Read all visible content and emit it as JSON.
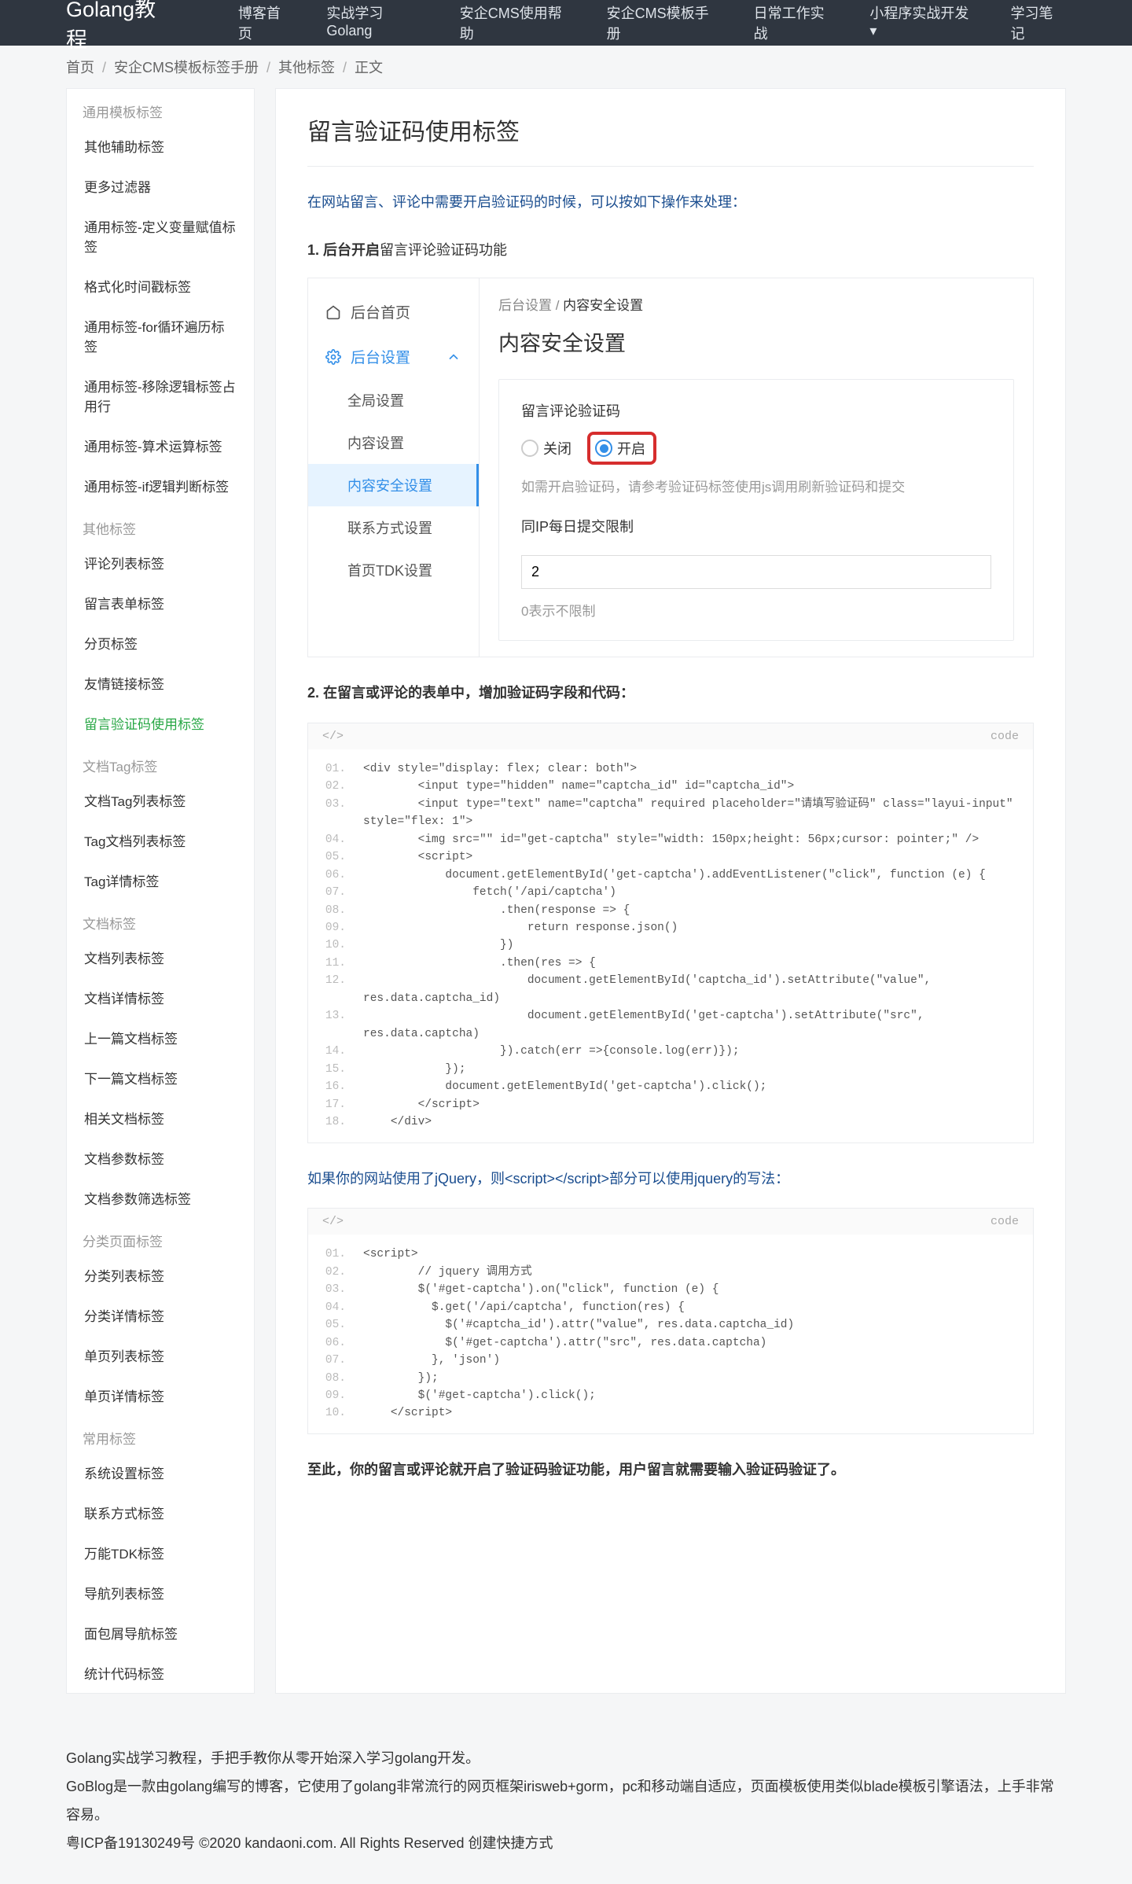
{
  "header": {
    "logo": "Golang教程",
    "nav": [
      "博客首页",
      "实战学习Golang",
      "安企CMS使用帮助",
      "安企CMS模板手册",
      "日常工作实战",
      "小程序实战开发 ▾",
      "学习笔记"
    ]
  },
  "breadcrumb": [
    "首页",
    "安企CMS模板标签手册",
    "其他标签",
    "正文"
  ],
  "sidebar": [
    {
      "title": "通用模板标签",
      "items": [
        "其他辅助标签",
        "更多过滤器",
        "通用标签-定义变量赋值标签",
        "格式化时间戳标签",
        "通用标签-for循环遍历标签",
        "通用标签-移除逻辑标签占用行",
        "通用标签-算术运算标签",
        "通用标签-if逻辑判断标签"
      ]
    },
    {
      "title": "其他标签",
      "items": [
        "评论列表标签",
        "留言表单标签",
        "分页标签",
        "友情链接标签",
        "留言验证码使用标签"
      ],
      "active": "留言验证码使用标签"
    },
    {
      "title": "文档Tag标签",
      "items": [
        "文档Tag列表标签",
        "Tag文档列表标签",
        "Tag详情标签"
      ]
    },
    {
      "title": "文档标签",
      "items": [
        "文档列表标签",
        "文档详情标签",
        "上一篇文档标签",
        "下一篇文档标签",
        "相关文档标签",
        "文档参数标签",
        "文档参数筛选标签"
      ]
    },
    {
      "title": "分类页面标签",
      "items": [
        "分类列表标签",
        "分类详情标签",
        "单页列表标签",
        "单页详情标签"
      ]
    },
    {
      "title": "常用标签",
      "items": [
        "系统设置标签",
        "联系方式标签",
        "万能TDK标签",
        "导航列表标签",
        "面包屑导航标签",
        "统计代码标签"
      ]
    }
  ],
  "content": {
    "title": "留言验证码使用标签",
    "p1": "在网站留言、评论中需要开启验证码的时候，可以按如下操作来处理：",
    "p2_prefix": "1. 后台开启",
    "p2_rest": "留言评论验证码功能",
    "ui": {
      "left": {
        "home": "后台首页",
        "setting": "后台设置",
        "subs": [
          "全局设置",
          "内容设置",
          "内容安全设置",
          "联系方式设置",
          "首页TDK设置"
        ],
        "sel": "内容安全设置"
      },
      "right": {
        "bc": "后台设置",
        "bc2": "内容安全设置",
        "h": "内容安全设置",
        "lbl1": "留言评论验证码",
        "off": "关闭",
        "on": "开启",
        "hint1": "如需开启验证码，请参考验证码标签使用js调用刷新验证码和提交",
        "lbl2": "同IP每日提交限制",
        "val": "2",
        "hint2": "0表示不限制"
      }
    },
    "p3": "2. 在留言或评论的表单中，增加验证码字段和代码：",
    "code1": [
      "<div style=\"display: flex; clear: both\">",
      "        <input type=\"hidden\" name=\"captcha_id\" id=\"captcha_id\">",
      "        <input type=\"text\" name=\"captcha\" required placeholder=\"请填写验证码\" class=\"layui-input\" style=\"flex: 1\">",
      "        <img src=\"\" id=\"get-captcha\" style=\"width: 150px;height: 56px;cursor: pointer;\" />",
      "        <script>",
      "            document.getElementById('get-captcha').addEventListener(\"click\", function (e) {",
      "                fetch('/api/captcha')",
      "                    .then(response => {",
      "                        return response.json()",
      "                    })",
      "                    .then(res => {",
      "                        document.getElementById('captcha_id').setAttribute(\"value\", res.data.captcha_id)",
      "                        document.getElementById('get-captcha').setAttribute(\"src\", res.data.captcha)",
      "                    }).catch(err =>{console.log(err)});",
      "            });",
      "            document.getElementById('get-captcha').click();",
      "        </script>",
      "    </div>"
    ],
    "p4": "如果你的网站使用了jQuery，则<script></script>部分可以使用jquery的写法：",
    "code2": [
      "<script>",
      "        // jquery 调用方式",
      "        $('#get-captcha').on(\"click\", function (e) {",
      "          $.get('/api/captcha', function(res) {",
      "            $('#captcha_id').attr(\"value\", res.data.captcha_id)",
      "            $('#get-captcha').attr(\"src\", res.data.captcha)",
      "          }, 'json')",
      "        });",
      "        $('#get-captcha').click();",
      "    </script>"
    ],
    "p5": "至此，你的留言或评论就开启了验证码验证功能，用户留言就需要输入验证码验证了。"
  },
  "footer": [
    "Golang实战学习教程，手把手教你从零开始深入学习golang开发。",
    "GoBlog是一款由golang编写的博客，它使用了golang非常流行的网页框架irisweb+gorm，pc和移动端自适应，页面模板使用类似blade模板引擎语法，上手非常容易。",
    "粤ICP备19130249号 ©2020 kandaoni.com. All Rights Reserved 创建快捷方式"
  ],
  "codeLabel": "code",
  "codeOpen": "</>"
}
